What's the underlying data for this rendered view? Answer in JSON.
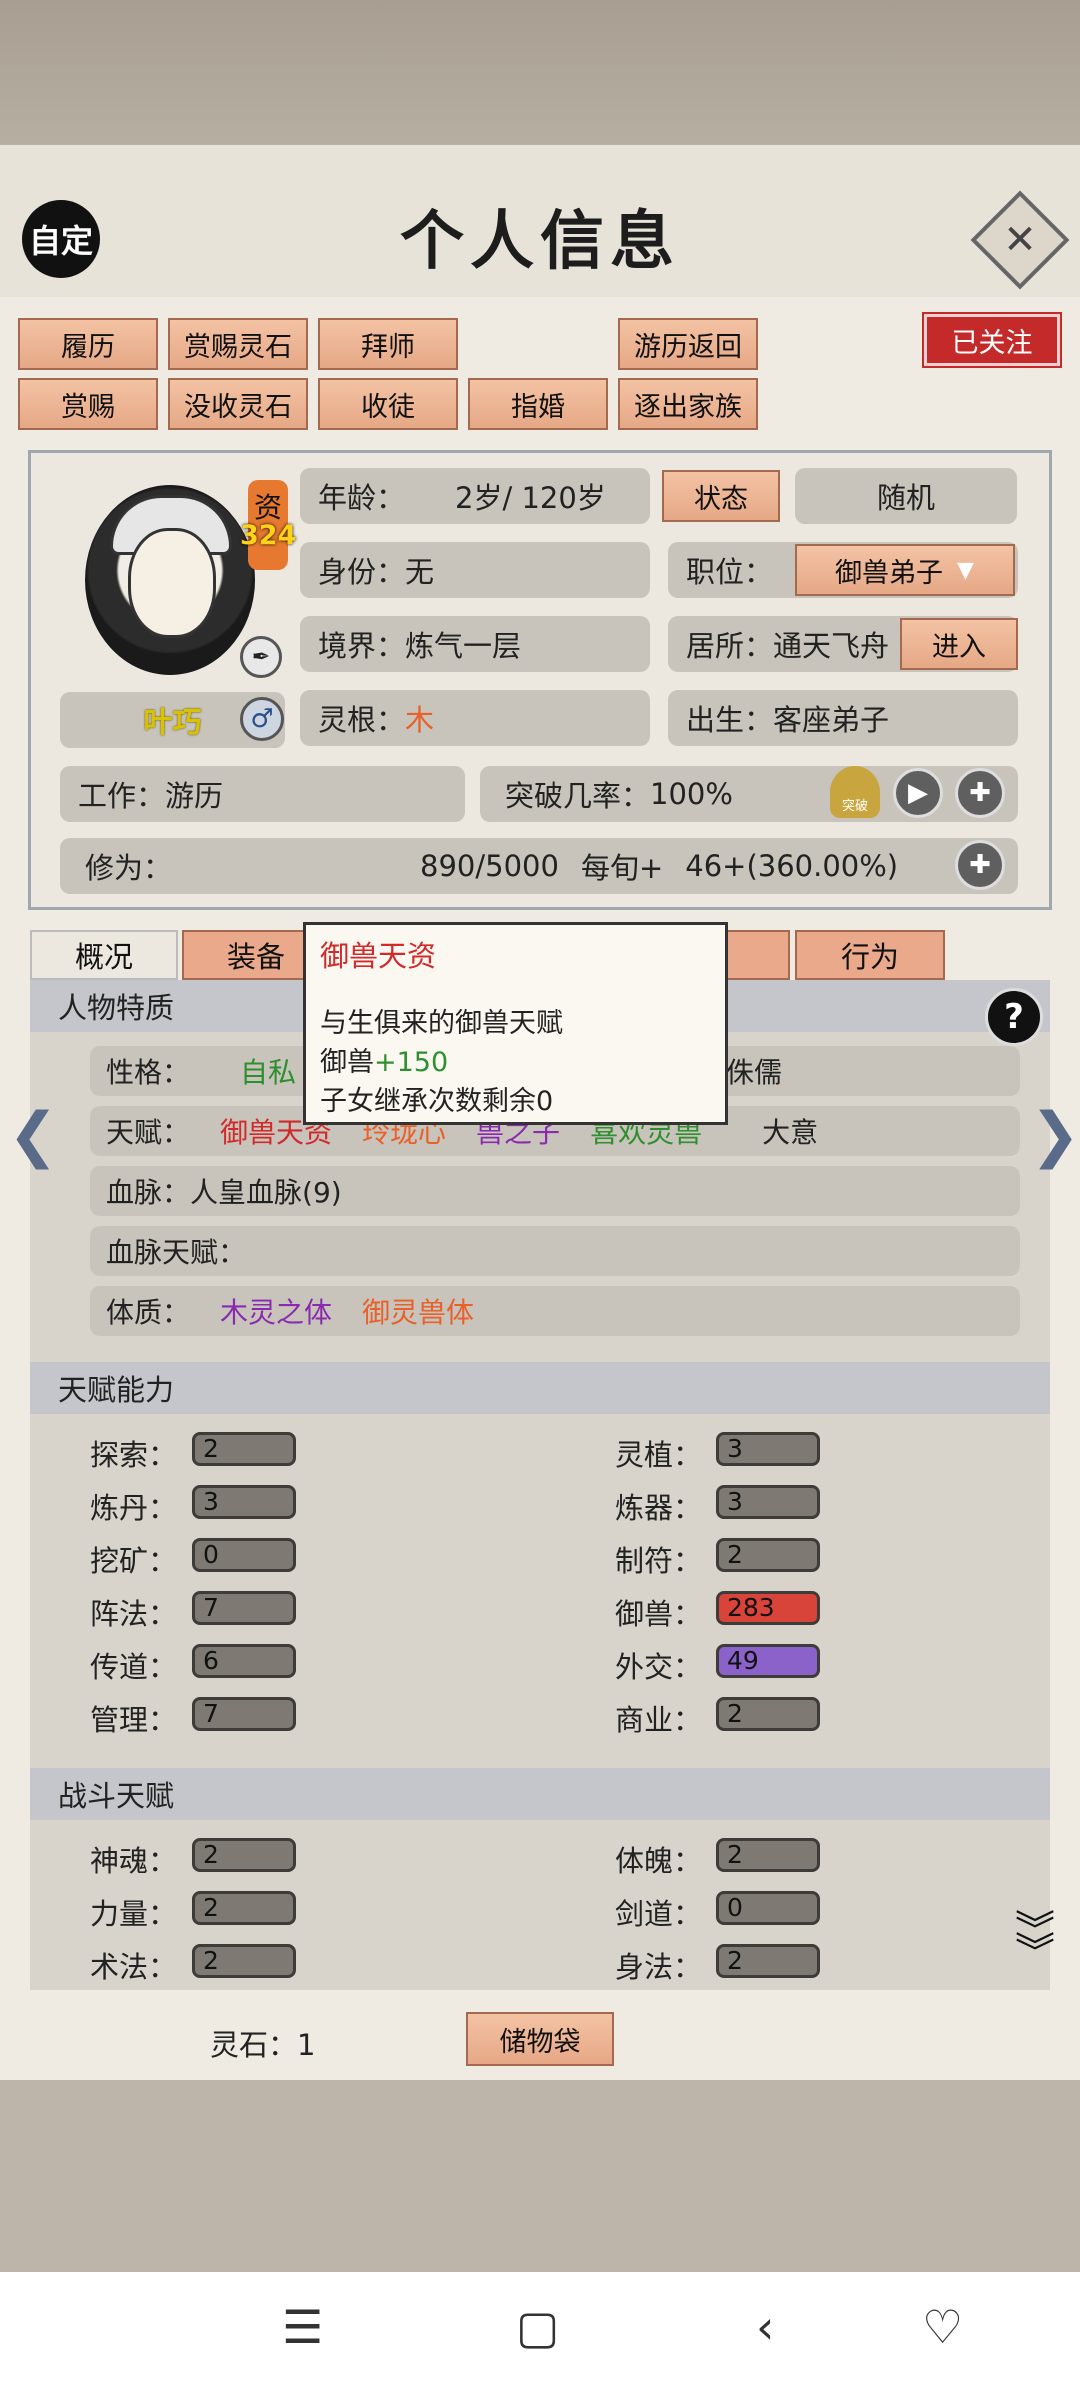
{
  "header": {
    "title": "个人信息",
    "auto_label": "自定",
    "close_label": "✕"
  },
  "actions": {
    "row1": [
      "履历",
      "赏赐灵石",
      "拜师",
      "游历返回"
    ],
    "row2": [
      "赏赐",
      "没收灵石",
      "收徒",
      "指婚",
      "逐出家族"
    ],
    "follow_badge": "已关注"
  },
  "profile": {
    "zi_label": "资",
    "zi_value": "324",
    "name": "叶巧",
    "gender_icon": "♂",
    "age_label": "年龄：",
    "age_value": "2岁/ 120岁",
    "status_button": "状态",
    "random_button": "随机",
    "identity_label": "身份：",
    "identity_value": "无",
    "position_label": "职位：",
    "position_value": "御兽弟子",
    "realm_label": "境界：",
    "realm_value": "炼气一层",
    "residence_label": "居所：",
    "residence_value": "通天飞舟",
    "enter_button": "进入",
    "root_label": "灵根：",
    "root_value": "木",
    "birth_label": "出生：",
    "birth_value": "客座弟子",
    "work_label": "工作：",
    "work_value": "游历",
    "breakthrough_label": "突破几率：",
    "breakthrough_value": "100%",
    "cultivation_label": "修为：",
    "cultivation_value": "890/5000",
    "per_term_label": "每旬+",
    "per_term_value": "46+(360.00%)",
    "breakthrough_icon_text": "突破"
  },
  "tabs": [
    "概况",
    "装备",
    "系",
    "行为"
  ],
  "tooltip": {
    "title": "御兽天资",
    "line1": "与生俱来的御兽天赋",
    "line2_prefix": "御兽",
    "line2_bonus": "+150",
    "line3": "子女继承次数剩余0"
  },
  "traits": {
    "section_title": "人物特质",
    "personality_label": "性格：",
    "personality_1": "自私",
    "personality_2": "侏儒",
    "talent_label": "天赋：",
    "talents": [
      "御兽天资",
      "玲珑心",
      "兽之子",
      "喜欢灵兽",
      "大意"
    ],
    "bloodline_label": "血脉：",
    "bloodline_value": "人皇血脉(9)",
    "bloodline_talent_label": "血脉天赋：",
    "physique_label": "体质：",
    "physique": [
      "木灵之体",
      "御灵兽体"
    ]
  },
  "abilities": {
    "section_title": "天赋能力",
    "left": [
      {
        "label": "探索：",
        "value": "2"
      },
      {
        "label": "炼丹：",
        "value": "3"
      },
      {
        "label": "挖矿：",
        "value": "0"
      },
      {
        "label": "阵法：",
        "value": "7"
      },
      {
        "label": "传道：",
        "value": "6"
      },
      {
        "label": "管理：",
        "value": "7"
      }
    ],
    "right": [
      {
        "label": "灵植：",
        "value": "3"
      },
      {
        "label": "炼器：",
        "value": "3"
      },
      {
        "label": "制符：",
        "value": "2"
      },
      {
        "label": "御兽：",
        "value": "283"
      },
      {
        "label": "外交：",
        "value": "49"
      },
      {
        "label": "商业：",
        "value": "2"
      }
    ]
  },
  "combat": {
    "section_title": "战斗天赋",
    "left": [
      {
        "label": "神魂：",
        "value": "2"
      },
      {
        "label": "力量：",
        "value": "2"
      },
      {
        "label": "术法：",
        "value": "2"
      }
    ],
    "right": [
      {
        "label": "体魄：",
        "value": "2"
      },
      {
        "label": "剑道：",
        "value": "0"
      },
      {
        "label": "身法：",
        "value": "2"
      }
    ]
  },
  "footer": {
    "spirit_stone_label": "灵石：",
    "spirit_stone_value": "1",
    "storage_button": "储物袋"
  },
  "colors": {
    "accent_button": "#e9a98a",
    "badge_red": "#c52a2a",
    "beast_bar": "#d9443a",
    "diplomacy_bar": "#8a62c9"
  }
}
